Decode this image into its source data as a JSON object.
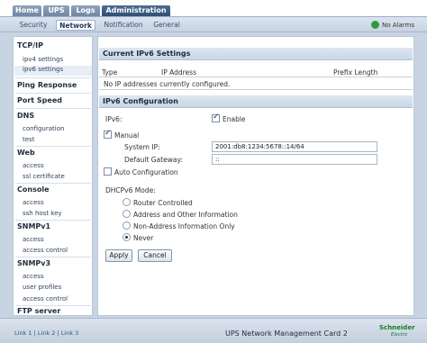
{
  "top_tabs": [
    "Home",
    "UPS",
    "Logs",
    "Administration"
  ],
  "sub_tabs": [
    "Security",
    "Network",
    "Notification",
    "General"
  ],
  "alarm_status": "No Alarms",
  "sidebar": {
    "tcpip": "TCP/IP",
    "ipv4": "ipv4 settings",
    "ipv6": "ipv6 settings",
    "ping": "Ping Response",
    "port": "Port Speed",
    "dns": "DNS",
    "dns_config": "configuration",
    "dns_test": "test",
    "web": "Web",
    "web_access": "access",
    "web_ssl": "ssl certificate",
    "console": "Console",
    "console_access": "access",
    "console_ssh": "ssh host key",
    "snmpv1": "SNMPv1",
    "snmpv1_access": "access",
    "snmpv1_control": "access control",
    "snmpv3": "SNMPv3",
    "snmpv3_access": "access",
    "snmpv3_profiles": "user profiles",
    "snmpv3_control": "access control",
    "ftp": "FTP server"
  },
  "current": {
    "title": "Current IPv6 Settings",
    "col_type": "Type",
    "col_ip": "IP Address",
    "col_prefix": "Prefix Length",
    "empty": "No IP addresses currently configured."
  },
  "config": {
    "title": "IPv6 Configuration",
    "ipv6_label": "IPv6:",
    "enable_label": "Enable",
    "enable_checked": true,
    "manual_label": "Manual",
    "manual_checked": true,
    "system_ip_label": "System IP:",
    "system_ip_value": "2001:db8:1234:5678::14/64",
    "gateway_label": "Default Gateway:",
    "gateway_value": "::",
    "auto_label": "Auto Configuration",
    "auto_checked": false,
    "dhcp_label": "DHCPv6 Mode:",
    "dhcp_options": [
      "Router Controlled",
      "Address and Other Information",
      "Non-Address Information Only",
      "Never"
    ],
    "dhcp_selected": "Never",
    "apply": "Apply",
    "cancel": "Cancel"
  },
  "footer": {
    "links": [
      "Link 1",
      "Link 2",
      "Link 3"
    ],
    "product": "UPS Network Management Card 2",
    "logo": "Schneider",
    "logo_sub": "Electric"
  },
  "colors": {
    "active_tab": "#2e4e78",
    "brand_green": "#1c7a2c",
    "alarm_ok": "#2e9b3b"
  }
}
